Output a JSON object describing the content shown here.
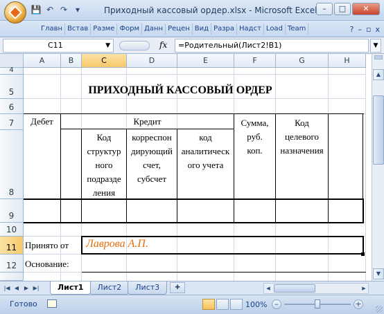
{
  "window": {
    "title": "Приходный кассовый ордер.xlsx - Microsoft Excel",
    "btn_minimize": "–",
    "btn_maximize": "□",
    "btn_close": "✕"
  },
  "qat": {
    "save": "💾",
    "undo": "↶",
    "redo": "↷",
    "customize": "▾"
  },
  "ribbon": {
    "tabs": [
      "Главн",
      "Встав",
      "Разме",
      "Форм",
      "Данн",
      "Рецен",
      "Вид",
      "Разра",
      "Надст",
      "Load",
      "Team"
    ],
    "help": "?",
    "min": "–",
    "restore": "▫",
    "close": "x"
  },
  "formula_bar": {
    "name_box": "C11",
    "fx": "fx",
    "formula": "=Родительный(Лист2!B1)"
  },
  "columns": [
    "A",
    "B",
    "C",
    "D",
    "E",
    "F",
    "G",
    "H"
  ],
  "selected_column": "C",
  "rows": [
    "4",
    "5",
    "6",
    "7",
    "8",
    "9",
    "10",
    "11",
    "12"
  ],
  "selected_row": "11",
  "sheet": {
    "title": "ПРИХОДНЫЙ КАССОВЫЙ ОРДЕР",
    "debit": "Дебет",
    "credit": "Кредит",
    "sum_l1": "Сумма,",
    "sum_l2": "руб.",
    "sum_l3": "коп.",
    "purpose_l1": "Код",
    "purpose_l2": "целевого",
    "purpose_l3": "назначения",
    "c8_l1": "Код",
    "c8_l2": "структур",
    "c8_l3": "ного",
    "c8_l4": "подразде",
    "c8_l5": "ления",
    "d8_l1": "корреспон",
    "d8_l2": "дирующий",
    "d8_l3": "счет,",
    "d8_l4": "субсчет",
    "e8_l1": "код",
    "e8_l2": "аналитическ",
    "e8_l3": "ого учета",
    "accepted_label": "Принято от",
    "accepted_value": "Лаврова А.П.",
    "basis_label": "Основание:"
  },
  "sheet_tabs": [
    "Лист1",
    "Лист2",
    "Лист3"
  ],
  "active_sheet": "Лист1",
  "status": {
    "ready": "Готово",
    "zoom": "100%",
    "zoom_level_percent": 100
  },
  "colors": {
    "accepted_value": "#e46c0a",
    "selection_header": "#f8c86c",
    "grid": "#d0d7e5"
  }
}
